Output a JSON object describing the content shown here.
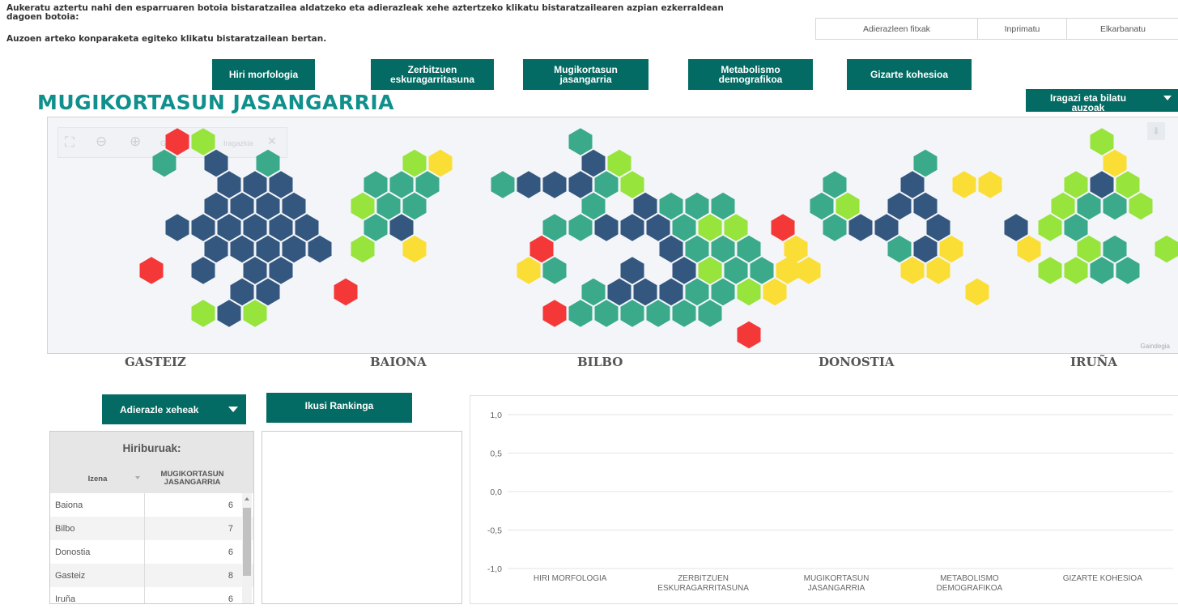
{
  "intro": {
    "line1": "Aukeratu aztertu nahi den esparruaren botoia bistaratzailea aldatzeko eta adierazleak xehe aztertzeko klikatu bistaratzailearen azpian ezkerraldean",
    "line2": "dagoen botoia:",
    "line3": "Auzoen arteko konparaketa egiteko klikatu bistaratzailean bertan."
  },
  "topbar": {
    "btn1": "Adierazleen fitxak",
    "btn2": "Inprimatu",
    "btn3": "Elkarbanatu"
  },
  "tabs": [
    {
      "l1": "Hiri morfologia",
      "l2": ""
    },
    {
      "l1": "Zerbitzuen",
      "l2": "eskuragarritasuna"
    },
    {
      "l1": "Mugikortasun",
      "l2": "jasangarria"
    },
    {
      "l1": "Metabolismo",
      "l2": "demografikoa"
    },
    {
      "l1": "Gizarte kohesioa",
      "l2": ""
    }
  ],
  "title": "MUGIKORTASUN JASANGARRIA",
  "filter": {
    "l1": "Iragazi eta bilatu",
    "l2": "auzoak"
  },
  "toolbar": {
    "t1": "Garbitu",
    "t2": "Iragazkia"
  },
  "credit": "Gaindegia",
  "cities": [
    "GASTEIZ",
    "BAIONA",
    "BILBO",
    "DONOSTIA",
    "IRUÑA"
  ],
  "colors": {
    "dark": "#34577f",
    "teal": "#3aaa8a",
    "lime": "#96e43c",
    "yellow": "#fbde35",
    "red": "#f43838",
    "brand": "#036b63"
  },
  "hexmap": {
    "GASTEIZ": {
      "D": [
        [
          7,
          1
        ],
        [
          8,
          2
        ],
        [
          9,
          2
        ],
        [
          10,
          2
        ],
        [
          7,
          3
        ],
        [
          8,
          3
        ],
        [
          9,
          3
        ],
        [
          10,
          3
        ],
        [
          6,
          4
        ],
        [
          7,
          4
        ],
        [
          8,
          4
        ],
        [
          9,
          4
        ],
        [
          10,
          4
        ],
        [
          11,
          4
        ],
        [
          7,
          5
        ],
        [
          8,
          5
        ],
        [
          9,
          5
        ],
        [
          10,
          5
        ],
        [
          11,
          5
        ],
        [
          7,
          6
        ],
        [
          9,
          6
        ],
        [
          10,
          6
        ],
        [
          8,
          7
        ],
        [
          9,
          7
        ],
        [
          8,
          8
        ]
      ],
      "T": [
        [
          5,
          1
        ],
        [
          9,
          1
        ]
      ],
      "L": [
        [
          7,
          0
        ],
        [
          7,
          8
        ],
        [
          9,
          8
        ]
      ],
      "Y": [],
      "R": [
        [
          6,
          0
        ],
        [
          5,
          6
        ],
        [
          12,
          7
        ]
      ]
    },
    "BAIONA": {
      "D": [
        [
          10,
          4
        ]
      ],
      "T": [
        [
          9,
          2
        ],
        [
          10,
          2
        ],
        [
          11,
          2
        ],
        [
          9,
          3
        ],
        [
          10,
          3
        ],
        [
          9,
          4
        ]
      ],
      "L": [
        [
          10,
          1
        ],
        [
          8,
          3
        ],
        [
          8,
          5
        ]
      ],
      "Y": [
        [
          11,
          1
        ],
        [
          10,
          5
        ]
      ],
      "R": []
    },
    "BILBO": {
      "D": [
        [
          8,
          1
        ],
        [
          6,
          2
        ],
        [
          7,
          2
        ],
        [
          8,
          2
        ],
        [
          10,
          3
        ],
        [
          11,
          4
        ],
        [
          9,
          4
        ],
        [
          10,
          4
        ],
        [
          11,
          5
        ],
        [
          12,
          6
        ],
        [
          10,
          6
        ],
        [
          11,
          7
        ],
        [
          9,
          7
        ],
        [
          10,
          7
        ]
      ],
      "T": [
        [
          8,
          0
        ],
        [
          5,
          2
        ],
        [
          9,
          2
        ],
        [
          8,
          3
        ],
        [
          7,
          4
        ],
        [
          8,
          4
        ],
        [
          11,
          3
        ],
        [
          12,
          3
        ],
        [
          13,
          3
        ],
        [
          12,
          4
        ],
        [
          13,
          5
        ],
        [
          14,
          5
        ],
        [
          12,
          5
        ],
        [
          13,
          6
        ],
        [
          14,
          6
        ],
        [
          15,
          6
        ],
        [
          7,
          6
        ],
        [
          8,
          7
        ],
        [
          8,
          8
        ],
        [
          12,
          7
        ],
        [
          13,
          7
        ],
        [
          9,
          8
        ],
        [
          10,
          8
        ],
        [
          11,
          8
        ],
        [
          12,
          8
        ],
        [
          13,
          8
        ]
      ],
      "L": [
        [
          9,
          1
        ],
        [
          10,
          2
        ],
        [
          13,
          4
        ],
        [
          14,
          4
        ],
        [
          13,
          6
        ],
        [
          14,
          7
        ]
      ],
      "Y": [
        [
          6,
          6
        ],
        [
          15,
          7
        ],
        [
          16,
          6
        ]
      ],
      "R": [
        [
          6,
          5
        ],
        [
          7,
          8
        ],
        [
          14,
          9
        ]
      ]
    },
    "DONOSTIA": {
      "D": [
        [
          13,
          2
        ],
        [
          12,
          3
        ],
        [
          13,
          3
        ],
        [
          14,
          4
        ],
        [
          11,
          4
        ],
        [
          12,
          4
        ],
        [
          13,
          5
        ],
        [
          17,
          4
        ]
      ],
      "T": [
        [
          13,
          1
        ],
        [
          10,
          2
        ],
        [
          9,
          3
        ],
        [
          10,
          4
        ],
        [
          12,
          5
        ]
      ],
      "L": [
        [
          10,
          3
        ]
      ],
      "Y": [
        [
          15,
          2
        ],
        [
          16,
          2
        ],
        [
          14,
          5
        ],
        [
          13,
          6
        ],
        [
          14,
          6
        ],
        [
          17,
          5
        ],
        [
          8,
          5
        ],
        [
          9,
          6
        ],
        [
          15,
          7
        ]
      ],
      "R": [
        [
          8,
          4
        ]
      ]
    },
    "IRUÑA": {
      "D": [
        [
          12,
          2
        ]
      ],
      "T": [
        [
          11,
          3
        ],
        [
          12,
          3
        ],
        [
          11,
          4
        ],
        [
          12,
          5
        ],
        [
          13,
          6
        ],
        [
          12,
          6
        ]
      ],
      "L": [
        [
          12,
          0
        ],
        [
          11,
          2
        ],
        [
          13,
          2
        ],
        [
          10,
          3
        ],
        [
          13,
          3
        ],
        [
          10,
          4
        ],
        [
          11,
          5
        ],
        [
          14,
          5
        ],
        [
          11,
          6
        ],
        [
          10,
          6
        ]
      ],
      "Y": [
        [
          12,
          1
        ]
      ],
      "R": []
    }
  },
  "bottom": {
    "dropdown": "Adierazle xeheak",
    "ranking": "Ikusi Rankinga",
    "table_title": "Hiriburuak:",
    "col1": "Izena",
    "col2a": "MUGIKORTASUN",
    "col2b": "JASANGARRIA",
    "rows": [
      {
        "name": "Baiona",
        "value": "6"
      },
      {
        "name": "Bilbo",
        "value": "7"
      },
      {
        "name": "Donostia",
        "value": "6"
      },
      {
        "name": "Gasteiz",
        "value": "8"
      },
      {
        "name": "Iruña",
        "value": "6"
      }
    ]
  },
  "chart_data": {
    "type": "line",
    "categories": [
      "HIRI MORFOLOGIA",
      "ZERBITZUEN ESKURAGARRITASUNA",
      "MUGIKORTASUN JASANGARRIA",
      "METABOLISMO DEMOGRAFIKOA",
      "GIZARTE KOHESIOA"
    ],
    "yticks": [
      "1,0",
      "0,5",
      "0,0",
      "-0,5",
      "-1,0"
    ],
    "ylim": [
      -1,
      1
    ],
    "series": []
  }
}
